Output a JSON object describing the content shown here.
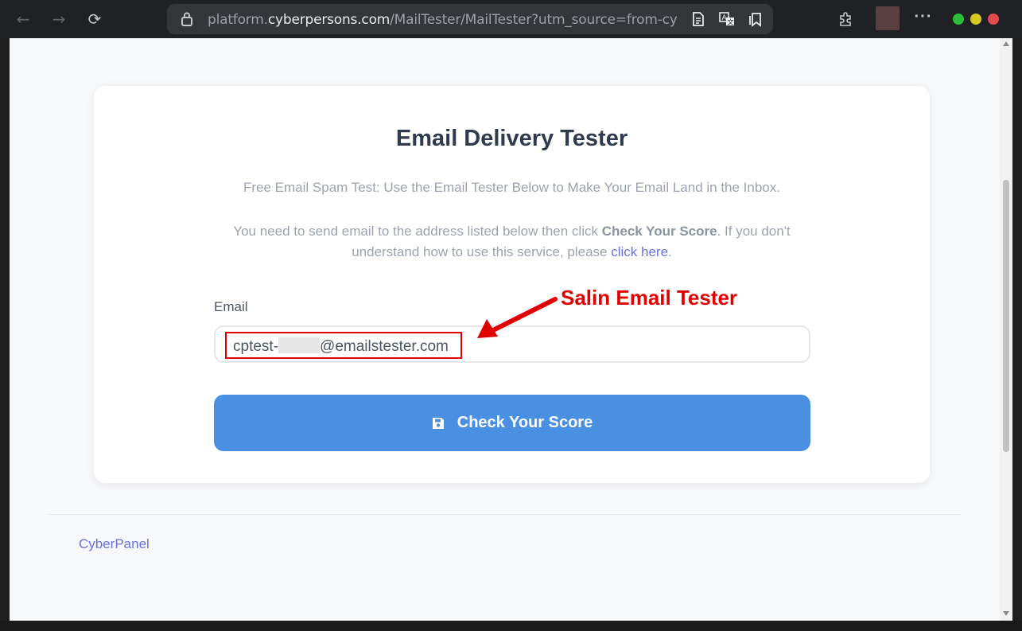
{
  "browser": {
    "url_prefix": "platform.",
    "url_domain": "cyberpersons.com",
    "url_rest": "/MailTester/MailTester?utm_source=from-cyberpar",
    "menu_dots": "···"
  },
  "card": {
    "title": "Email Delivery Tester",
    "subtitle": "Free Email Spam Test: Use the Email Tester Below to Make Your Email Land in the Inbox.",
    "instructions_part1": "You need to send email to the address listed below then click ",
    "instructions_bold": "Check Your Score",
    "instructions_part2": ". If you don't understand how to use this service, please ",
    "instructions_link": "click here",
    "instructions_end": "."
  },
  "form": {
    "email_label": "Email",
    "email_prefix": "cptest-",
    "email_suffix": "@emailstester.com",
    "submit_label": "Check Your Score"
  },
  "annotation": {
    "text": "Salin Email Tester",
    "color": "#e00000"
  },
  "footer": {
    "link": "CyberPanel"
  },
  "colors": {
    "button": "#4a90e2",
    "link": "#6a71e0",
    "title": "#2f3b4c"
  }
}
